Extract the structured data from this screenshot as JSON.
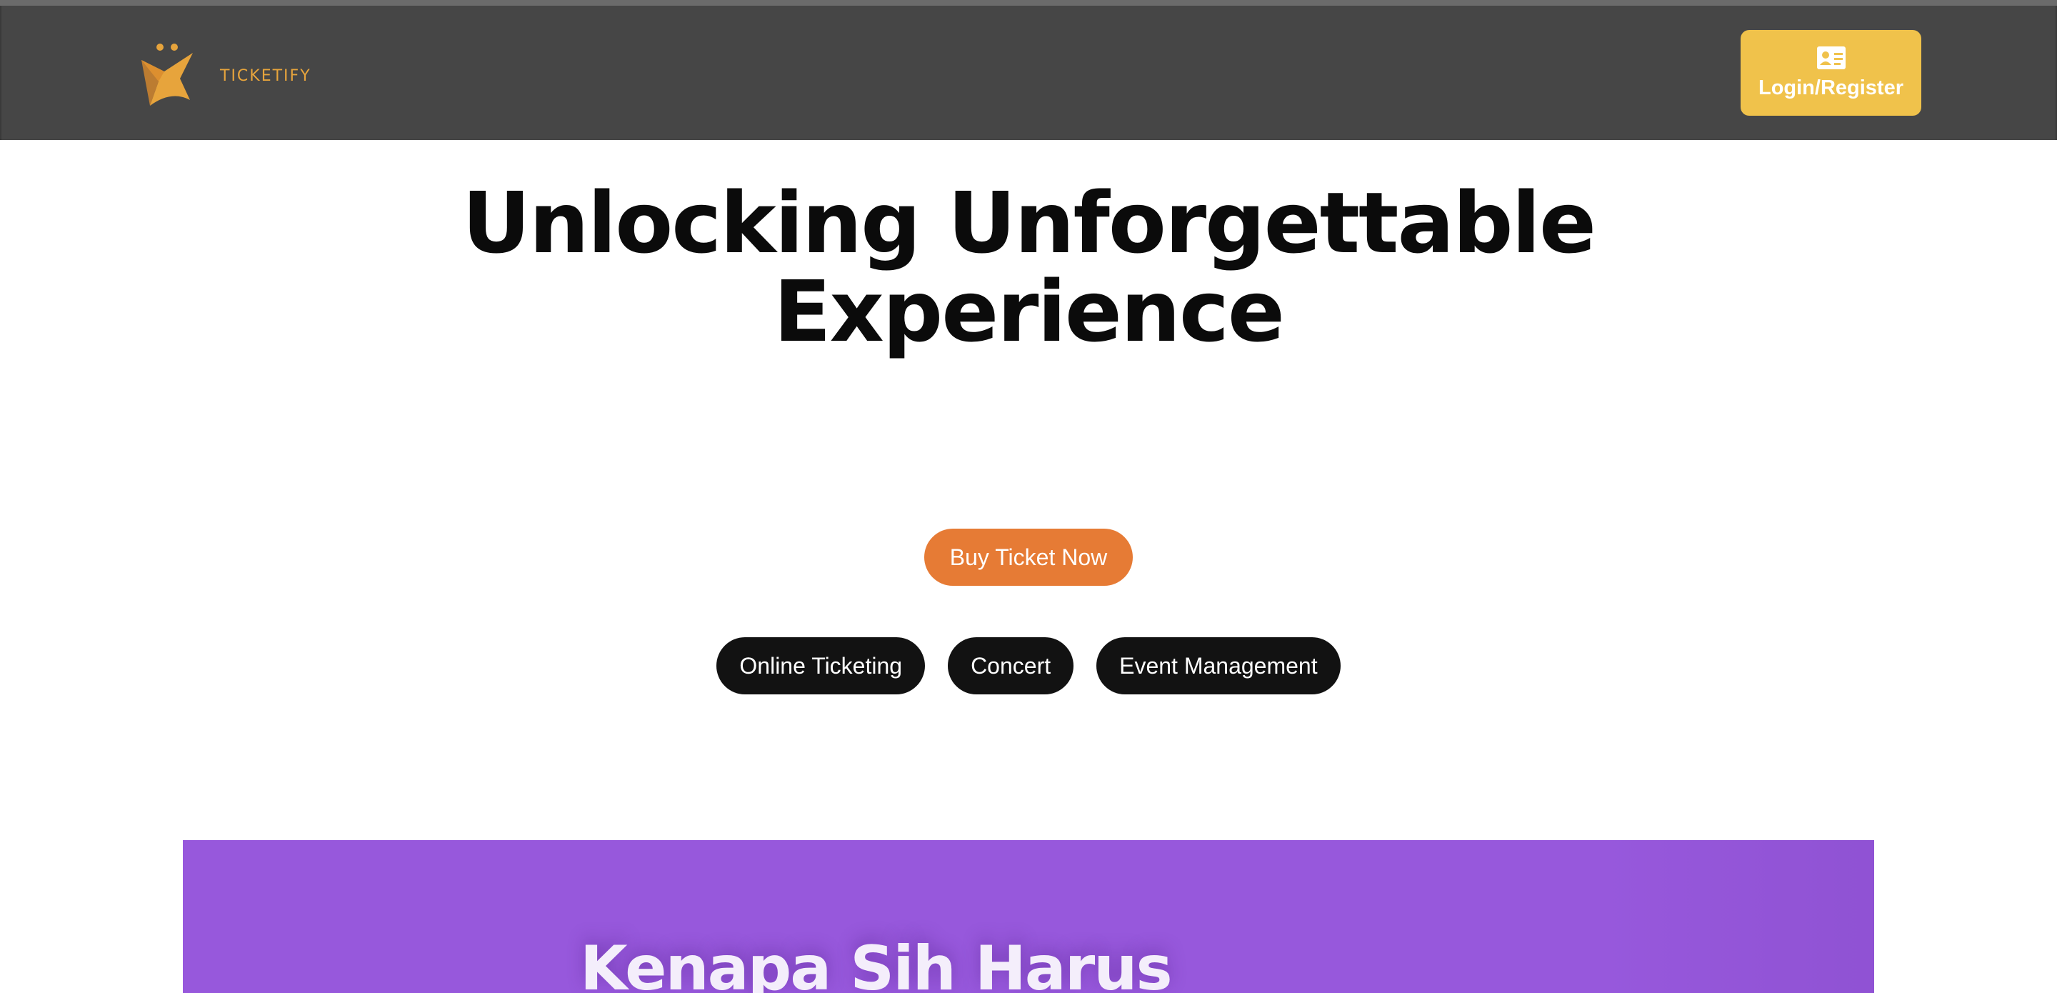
{
  "header": {
    "brand_name": "TICKETIFY",
    "login_label": "Login/Register",
    "logo_icon": "star-figure-logo-icon",
    "login_icon": "id-card-icon"
  },
  "hero": {
    "title_line1": "Unlocking Unforgettable",
    "title_line2": "Experience",
    "cta_label": "Buy Ticket Now",
    "tags": [
      "Online Ticketing",
      "Concert",
      "Event Management"
    ]
  },
  "banner": {
    "title": "Kenapa Sih Harus"
  },
  "colors": {
    "navbar_bg": "#464646",
    "brand_gold": "#e7a43c",
    "login_button": "#f0c24b",
    "cta_orange": "#e67b35",
    "tag_bg": "#121212",
    "banner_purple": "#9758dc"
  }
}
